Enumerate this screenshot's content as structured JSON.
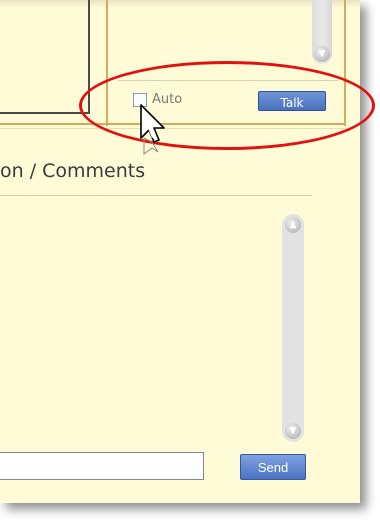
{
  "talk_controls": {
    "auto_checkbox_checked": false,
    "auto_label": "Auto",
    "talk_label": "Talk"
  },
  "comments": {
    "title": "on / Comments",
    "message_value": "",
    "send_label": "Send"
  },
  "icons": {
    "scroll_up": "chevron-up-icon",
    "scroll_down": "chevron-down-icon",
    "pointer": "mouse-pointer-icon"
  },
  "colors": {
    "panel_background": "#fffbd6",
    "button_blue": "#4a71bd",
    "highlight_ellipse": "#e31010",
    "separator": "#d7a95c"
  }
}
